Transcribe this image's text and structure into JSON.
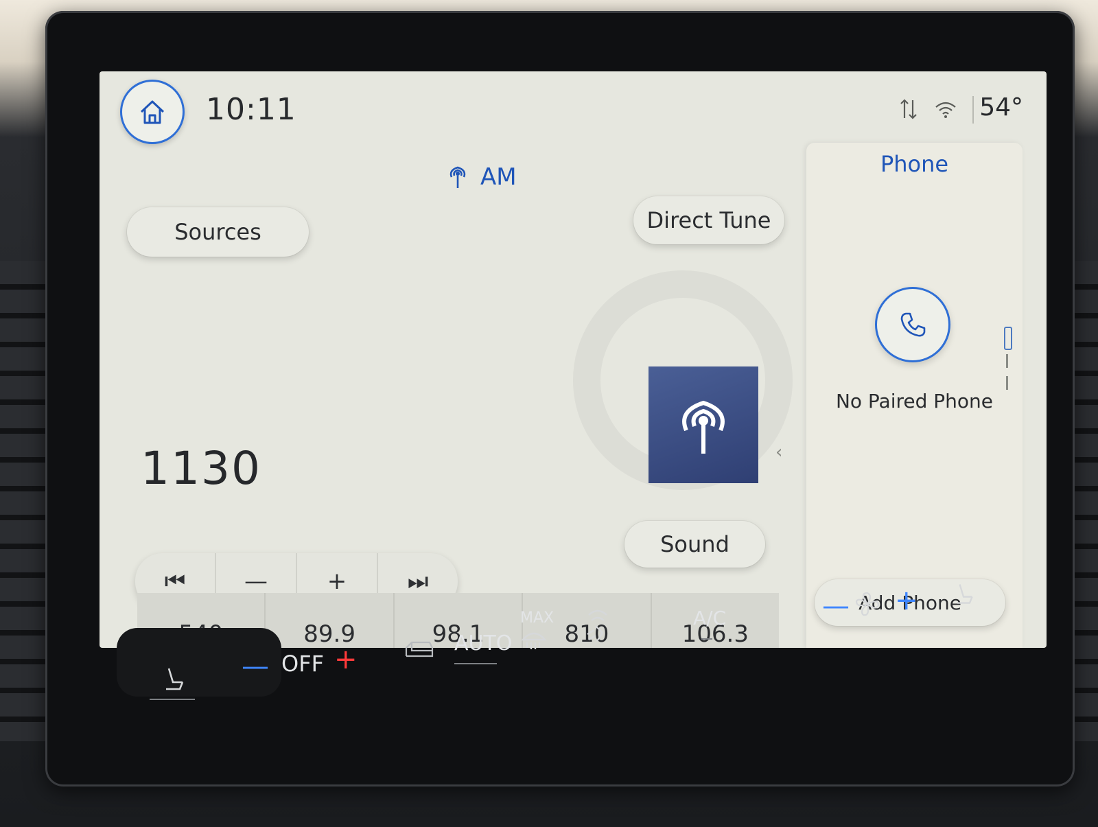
{
  "status_bar": {
    "time": "10:11",
    "temperature": "54°",
    "icons": [
      "home-icon",
      "data-transfer-icon",
      "wifi-hotspot-icon"
    ]
  },
  "audio": {
    "source_name": "AM",
    "source_icon": "radio-antenna-icon",
    "sources_label": "Sources",
    "direct_tune_label": "Direct Tune",
    "sound_label": "Sound",
    "current_frequency": "1130",
    "transport": [
      {
        "icon": "skip-back-icon",
        "label": "⏮"
      },
      {
        "icon": "tune-down-icon",
        "label": "—"
      },
      {
        "icon": "tune-up-icon",
        "label": "+"
      },
      {
        "icon": "skip-forward-icon",
        "label": "⏭"
      }
    ],
    "presets": [
      "540",
      "89.9",
      "98.1",
      "810",
      "106.3"
    ]
  },
  "phone": {
    "title": "Phone",
    "status": "No Paired Phone",
    "add_label": "Add Phone"
  },
  "climate": {
    "driver_temp": "OFF",
    "auto_label": "AUTO",
    "max_label": "MAX",
    "ac_label": "A/C"
  },
  "colors": {
    "accent_blue": "#1f55b8",
    "screen_bg": "#e6e7df",
    "plus_red": "#ff3a3a",
    "minus_blue": "#3f86ff"
  }
}
